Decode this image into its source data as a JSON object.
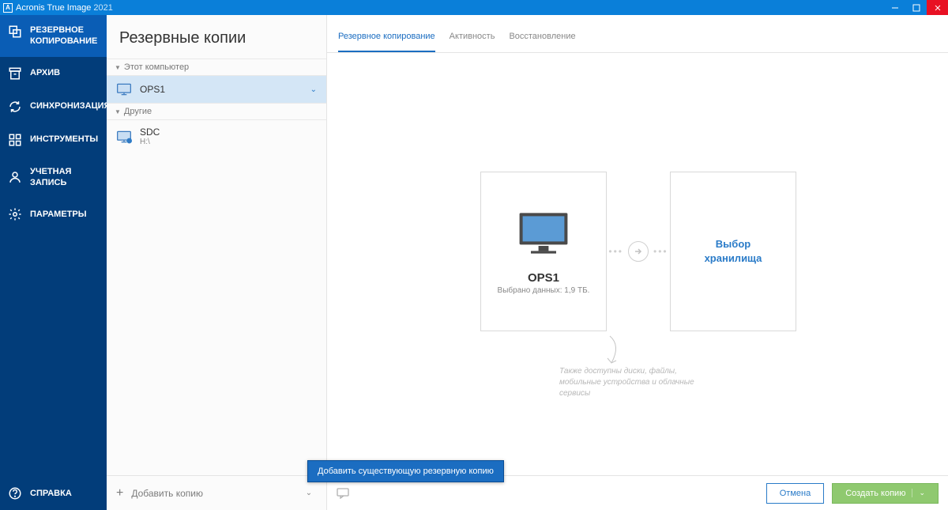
{
  "titlebar": {
    "app_name": "Acronis True Image",
    "year": "2021"
  },
  "nav": {
    "backup": "РЕЗЕРВНОЕ КОПИРОВАНИЕ",
    "archive": "АРХИВ",
    "sync": "СИНХРОНИЗАЦИЯ",
    "tools": "ИНСТРУМЕНТЫ",
    "account": "УЧЕТНАЯ ЗАПИСЬ",
    "settings": "ПАРАМЕТРЫ",
    "help": "СПРАВКА"
  },
  "listpanel": {
    "header": "Резервные копии",
    "group_this": "Этот компьютер",
    "group_other": "Другие",
    "items": [
      {
        "name": "OPS1"
      },
      {
        "name": "SDC",
        "sub": "H:\\"
      }
    ],
    "add_label": "Добавить копию",
    "tooltip": "Добавить существующую резервную копию"
  },
  "tabs": {
    "backup": "Резервное копирование",
    "activity": "Активность",
    "recovery": "Восстановление"
  },
  "source_card": {
    "title": "OPS1",
    "subtitle": "Выбрано данных: 1,9 ТБ."
  },
  "dest_card": {
    "line1": "Выбор",
    "line2": "хранилища"
  },
  "hint": "Также доступны диски, файлы, мобильные устройства и облачные сервисы",
  "actions": {
    "cancel": "Отмена",
    "create": "Создать копию"
  }
}
